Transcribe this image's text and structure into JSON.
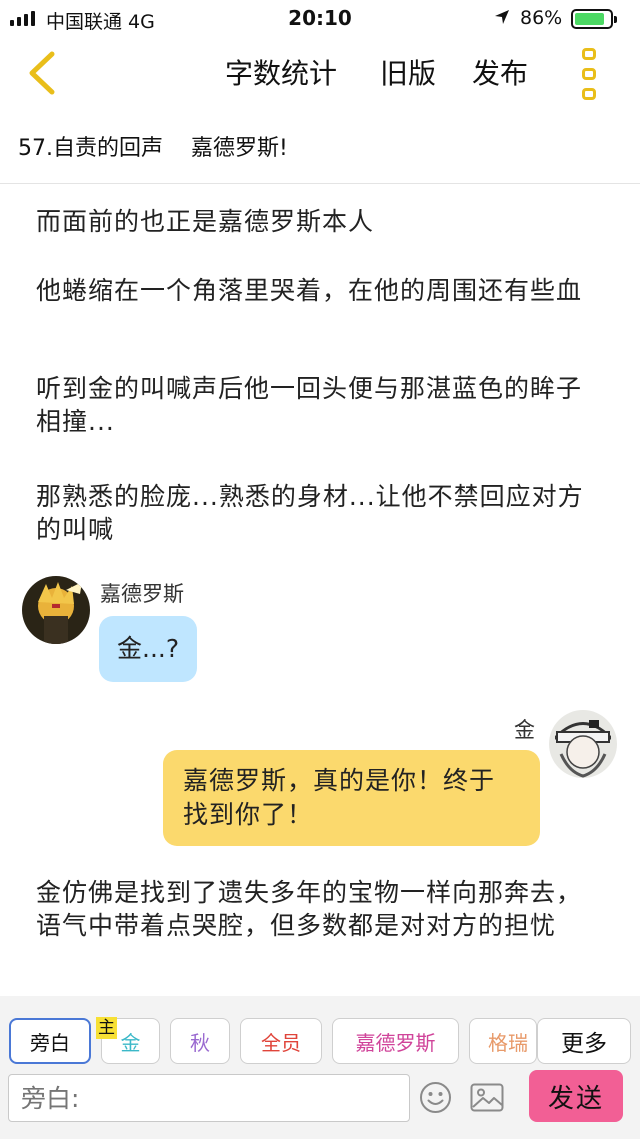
{
  "status_bar": {
    "carrier": "中国联通  4G",
    "time": "20:10",
    "battery_percent": "86%",
    "battery_level": 0.86,
    "location_icon": "location-arrow-icon"
  },
  "nav": {
    "back_icon": "chevron-left-icon",
    "word_count": "字数统计",
    "old_version": "旧版",
    "publish": "发布",
    "more_icon": "more-vertical-icon",
    "accent_color": "#e9be1a"
  },
  "chapter": {
    "title": "57.自责的回声    嘉德罗斯!"
  },
  "story": {
    "narration_1": "而面前的也正是嘉德罗斯本人",
    "narration_2": "他蜷缩在一个角落里哭着，在他的周围还有些血",
    "narration_3": "听到金的叫喊声后他一回头便与那湛蓝色的眸子相撞...",
    "narration_4": "那熟悉的脸庞...熟悉的身材...让他不禁回应对方的叫喊",
    "msg_1": {
      "speaker": "嘉德罗斯",
      "text": "金...?",
      "color": "#bfe6ff"
    },
    "msg_2": {
      "speaker": "金",
      "text": "嘉德罗斯，真的是你！终于找到你了！",
      "color": "#fbd96d"
    },
    "narration_5": "金仿佛是找到了遗失多年的宝物一样向那奔去，语气中带着点哭腔，但多数都是对对方的担忧"
  },
  "roles": {
    "narrator": "旁白",
    "main_tag": "主",
    "jin": "金",
    "qiu": "秋",
    "all": "全员",
    "grey": "嘉德罗斯",
    "grey_partial": "格瑞",
    "more": "更多",
    "colors": {
      "jin": "#3bb8c8",
      "qiu": "#9a6ad0",
      "all": "#e0443a",
      "grey": "#d0449a",
      "grey_partial": "#e89a6a"
    }
  },
  "composer": {
    "placeholder": "旁白:",
    "emoji_icon": "smiley-icon",
    "image_icon": "image-icon",
    "send_label": "发送",
    "send_color": "#f25f95"
  }
}
